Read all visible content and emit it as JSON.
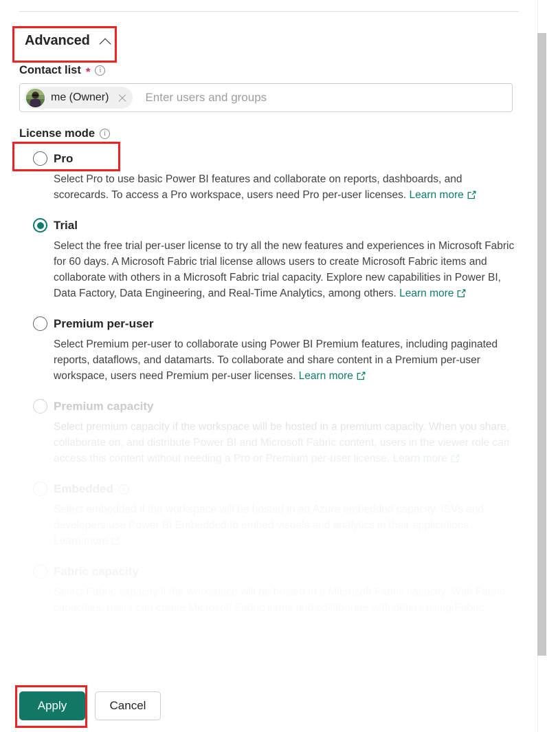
{
  "section": {
    "title": "Advanced",
    "collapse_icon": "chevron-up-icon"
  },
  "contact_list": {
    "label": "Contact list",
    "required_marker": "*",
    "info_icon": "info-icon",
    "pill": {
      "name": "me (Owner)",
      "avatar": "user-avatar",
      "remove_icon": "close-icon"
    },
    "placeholder": "Enter users and groups"
  },
  "license_mode": {
    "label": "License mode",
    "info_icon": "info-icon",
    "selected": "Trial",
    "options": [
      {
        "id": "pro",
        "title": "Pro",
        "description": "Select Pro to use basic Power BI features and collaborate on reports, dashboards, and scorecards. To access a Pro workspace, users need Pro per-user licenses.",
        "learn_more": "Learn more",
        "selected": false,
        "disabled": false,
        "has_info_icon": false
      },
      {
        "id": "trial",
        "title": "Trial",
        "description": "Select the free trial per-user license to try all the new features and experiences in Microsoft Fabric for 60 days. A Microsoft Fabric trial license allows users to create Microsoft Fabric items and collaborate with others in a Microsoft Fabric trial capacity. Explore new capabilities in Power BI, Data Factory, Data Engineering, and Real-Time Analytics, among others.",
        "learn_more": "Learn more",
        "selected": true,
        "disabled": false,
        "has_info_icon": false
      },
      {
        "id": "premium-per-user",
        "title": "Premium per-user",
        "description": "Select Premium per-user to collaborate using Power BI Premium features, including paginated reports, dataflows, and datamarts. To collaborate and share content in a Premium per-user workspace, users need Premium per-user licenses.",
        "learn_more": "Learn more",
        "selected": false,
        "disabled": false,
        "has_info_icon": false
      },
      {
        "id": "premium-capacity",
        "title": "Premium capacity",
        "description": "Select premium capacity if the workspace will be hosted in a premium capacity. When you share, collaborate on, and distribute Power BI and Microsoft Fabric content, users in the viewer role can access this content without needing a Pro or Premium per-user license.",
        "learn_more": "Learn more",
        "selected": false,
        "disabled": true,
        "has_info_icon": false
      },
      {
        "id": "embedded",
        "title": "Embedded",
        "description": "Select embedded if the workspace will be hosted in an Azure embedded capacity. ISVs and developers use Power BI Embedded to embed visuals and analytics in their applications.",
        "learn_more": "Learn more",
        "selected": false,
        "disabled": true,
        "has_info_icon": true
      },
      {
        "id": "fabric-capacity",
        "title": "Fabric capacity",
        "description": "Select Fabric capacity if the workspace will be hosted in a Microsoft Fabric capacity. With Fabric capacities, users can create Microsoft Fabric items and collaborate with others using Fabric",
        "learn_more": "",
        "selected": false,
        "disabled": true,
        "has_info_icon": false
      }
    ]
  },
  "footer": {
    "apply_label": "Apply",
    "cancel_label": "Cancel"
  },
  "colors": {
    "accent_green": "#0F7B6C",
    "apply_button": "#117865",
    "annotation_red": "#EE2222",
    "required_red": "#C4314B",
    "text_primary": "#242424",
    "text_disabled": "#BDBDBD"
  }
}
